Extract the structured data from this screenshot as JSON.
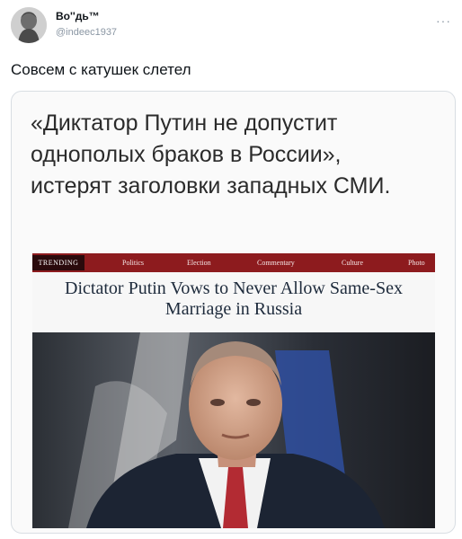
{
  "tweet": {
    "author_name": "Boʹʹдь™",
    "handle": "@indeec1937",
    "more_label": "···",
    "text": "Совсем с катушек слетел"
  },
  "image": {
    "quote_text": "«Диктатор Путин не допустит однополых браков в России», истерят заголовки западных СМИ.",
    "article": {
      "nav": {
        "trending": "TRENDING",
        "items": [
          "Politics",
          "Election",
          "Commentary",
          "Culture",
          "Photo"
        ]
      },
      "headline": "Dictator Putin Vows to Never Allow Same-Sex Marriage in Russia"
    }
  },
  "colors": {
    "nav_bar": "#8d1b1e",
    "headline_text": "#1e2b3c"
  }
}
